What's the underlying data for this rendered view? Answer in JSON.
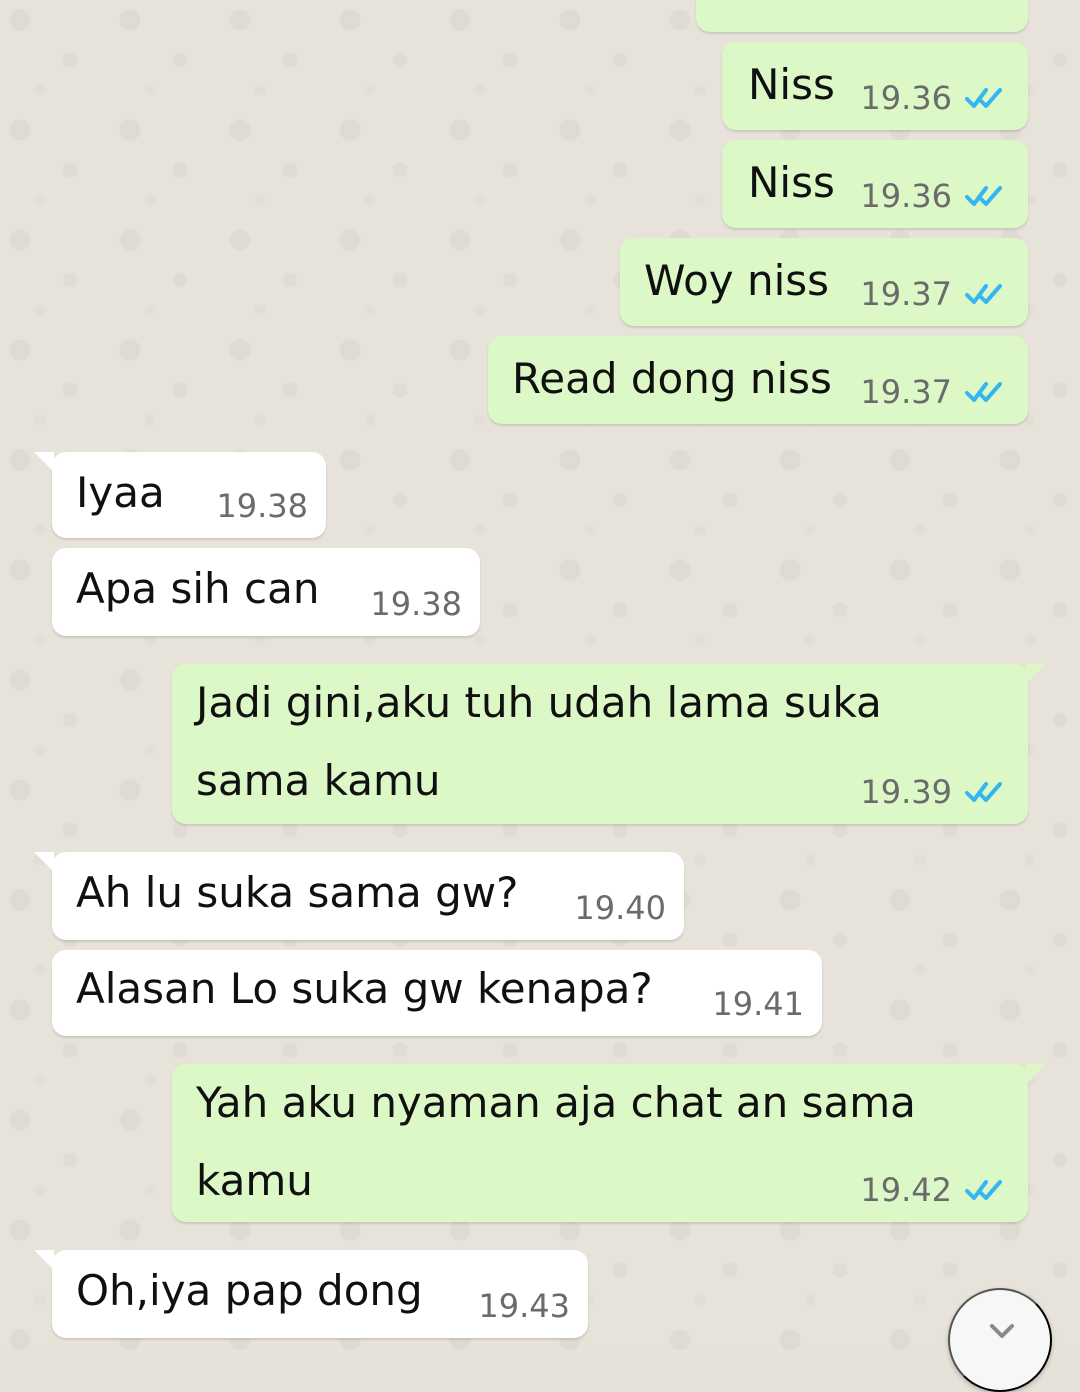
{
  "messages": [
    {
      "text": "Niss",
      "time": "19.36",
      "direction": "out",
      "status": "read"
    },
    {
      "text": "Niss",
      "time": "19.36",
      "direction": "out",
      "status": "read"
    },
    {
      "text": "Woy niss",
      "time": "19.37",
      "direction": "out",
      "status": "read"
    },
    {
      "text": "Read dong niss",
      "time": "19.37",
      "direction": "out",
      "status": "read"
    },
    {
      "text": "Iyaa",
      "time": "19.38",
      "direction": "in"
    },
    {
      "text": "Apa sih can",
      "time": "19.38",
      "direction": "in"
    },
    {
      "text": "Jadi gini,aku tuh udah lama suka sama kamu",
      "time": "19.39",
      "direction": "out",
      "status": "read"
    },
    {
      "text": "Ah lu suka sama gw?",
      "time": "19.40",
      "direction": "in"
    },
    {
      "text": "Alasan Lo suka gw kenapa?",
      "time": "19.41",
      "direction": "in"
    },
    {
      "text": "Yah aku nyaman aja chat an sama kamu",
      "time": "19.42",
      "direction": "out",
      "status": "read"
    },
    {
      "text": "Oh,iya pap dong",
      "time": "19.43",
      "direction": "in"
    }
  ],
  "icons": {
    "read": "double-check-icon",
    "scroll": "chevron-down-icon"
  },
  "colors": {
    "outgoing_bubble": "#dcf8c6",
    "incoming_bubble": "#ffffff",
    "read_check": "#34b7f1",
    "timestamp": "#6b6b6b"
  }
}
